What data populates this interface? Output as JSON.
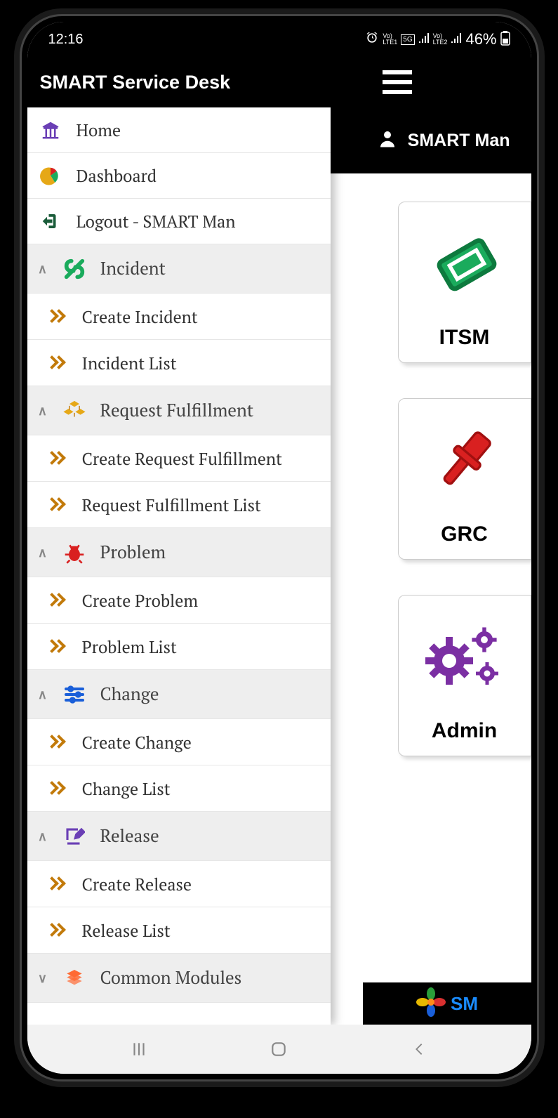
{
  "status": {
    "time": "12:16",
    "battery_pct": "46%"
  },
  "header": {
    "title": "SMART Service Desk"
  },
  "user": {
    "name": "SMART Man"
  },
  "modules": [
    {
      "label": "ITSM"
    },
    {
      "label": "GRC"
    },
    {
      "label": "Admin"
    }
  ],
  "footer": {
    "brand_prefix": "SM"
  },
  "menu": {
    "home": "Home",
    "dashboard": "Dashboard",
    "logout": "Logout - SMART Man",
    "sections": {
      "incident": {
        "label": "Incident",
        "create": "Create Incident",
        "list": "Incident List"
      },
      "request": {
        "label": "Request Fulfillment",
        "create": "Create Request Fulfillment",
        "list": "Request Fulfillment List"
      },
      "problem": {
        "label": "Problem",
        "create": "Create Problem",
        "list": "Problem List"
      },
      "change": {
        "label": "Change",
        "create": "Create Change",
        "list": "Change List"
      },
      "release": {
        "label": "Release",
        "create": "Create Release",
        "list": "Release List"
      },
      "common": {
        "label": "Common Modules"
      }
    }
  }
}
